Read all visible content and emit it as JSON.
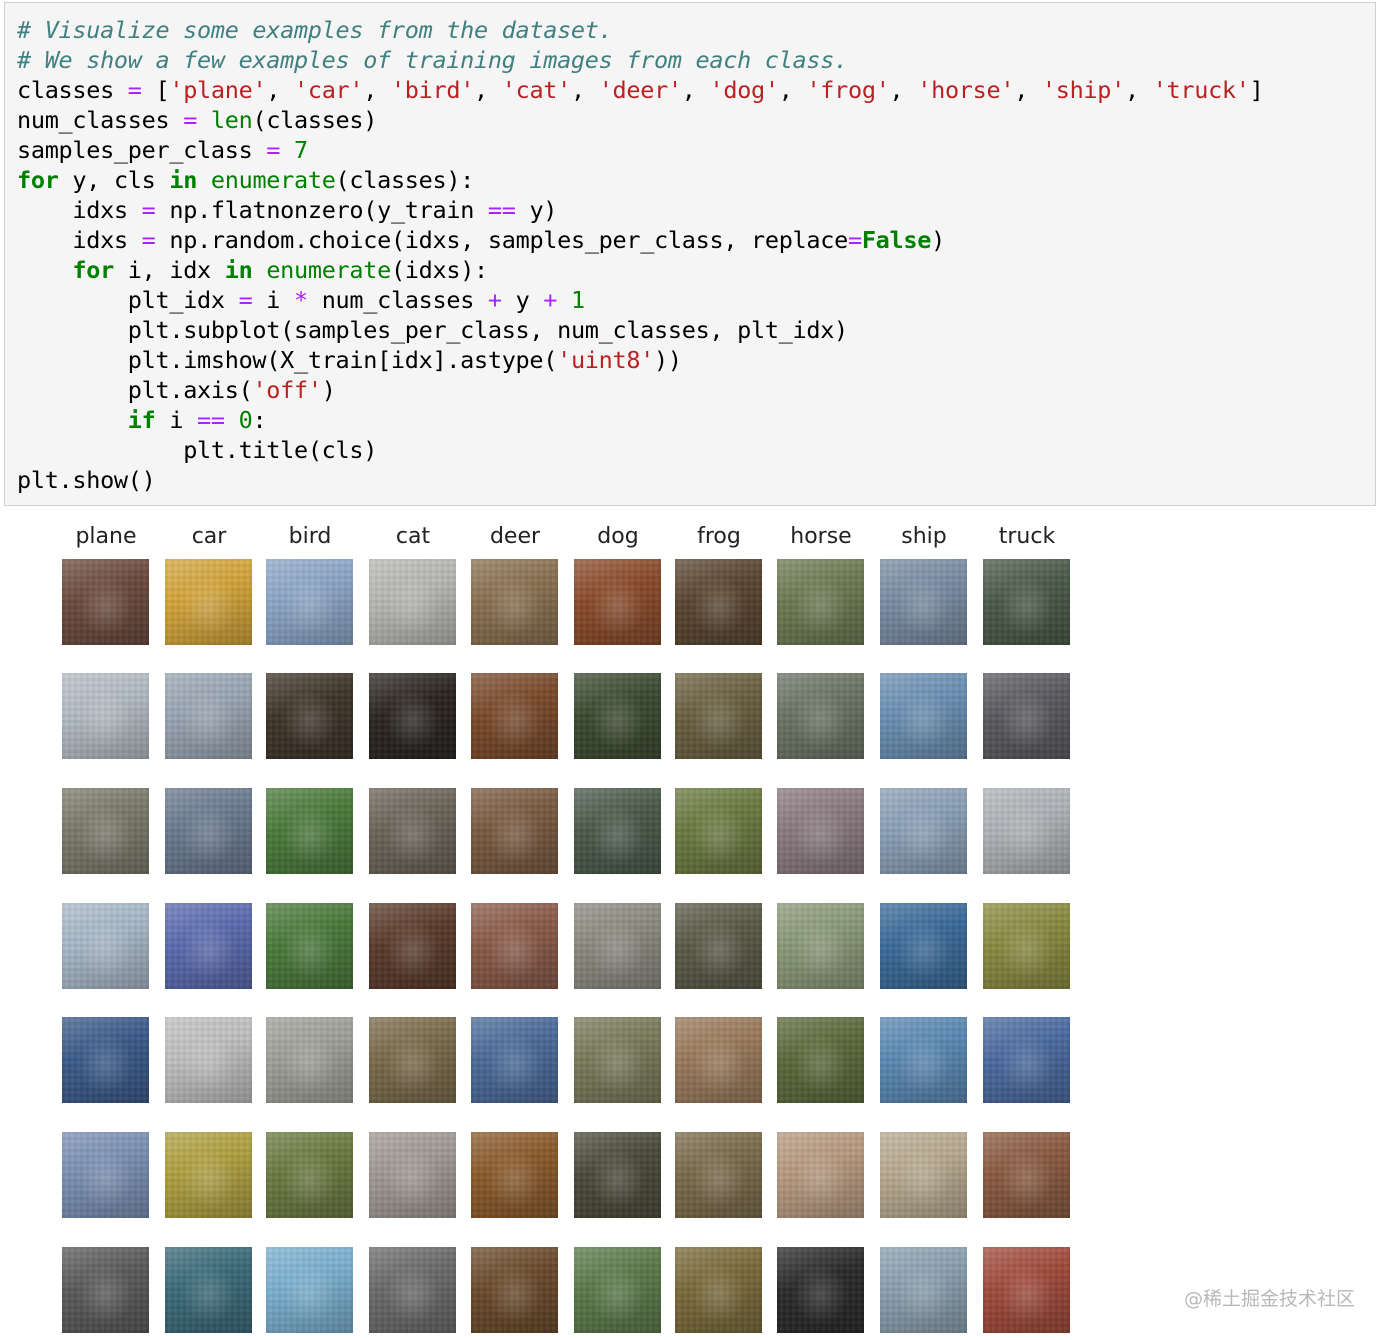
{
  "code": {
    "comment1": "# Visualize some examples from the dataset.",
    "comment2": "# We show a few examples of training images from each class.",
    "line_classes": {
      "var": "classes",
      "items": [
        "'plane'",
        "'car'",
        "'bird'",
        "'cat'",
        "'deer'",
        "'dog'",
        "'frog'",
        "'horse'",
        "'ship'",
        "'truck'"
      ]
    },
    "line_num_classes": {
      "var": "num_classes",
      "fn": "len",
      "arg": "(classes)"
    },
    "line_samples": {
      "var": "samples_per_class",
      "value": "7"
    },
    "line_for1": {
      "kw_for": "for",
      "vars": " y, cls ",
      "kw_in": "in",
      "fn": "enumerate",
      "arg": "(classes):"
    },
    "line_idxs1": {
      "var": "idxs",
      "call": "np.flatnonzero(y_train ",
      "op": "==",
      "rest": " y)"
    },
    "line_idxs2": {
      "var": "idxs",
      "call": "np.random.choice(idxs, samples_per_class, replace",
      "op": "=",
      "kw": "False",
      "rest": ")"
    },
    "line_for2": {
      "kw_for": "for",
      "vars": " i, idx ",
      "kw_in": "in",
      "fn": "enumerate",
      "arg": "(idxs):"
    },
    "line_pltidx": {
      "var": "plt_idx",
      "a": " i ",
      "b": " num_classes ",
      "c": " y ",
      "one": "1"
    },
    "line_subplot": "plt.subplot(samples_per_class, num_classes, plt_idx)",
    "line_imshow": {
      "pre": "plt.imshow(X_train[idx].astype(",
      "str": "'uint8'",
      "post": "))"
    },
    "line_axis": {
      "pre": "plt.axis(",
      "str": "'off'",
      "post": ")"
    },
    "line_if": {
      "kw": "if",
      "mid": " i ",
      "op": "==",
      "zero": "0",
      "post": ":"
    },
    "line_title": "plt.title(cls)",
    "line_show": "plt.show()"
  },
  "output": {
    "titles": [
      "plane",
      "car",
      "bird",
      "cat",
      "deer",
      "dog",
      "frog",
      "horse",
      "ship",
      "truck"
    ],
    "tile_colors": [
      [
        "#6b4a3c",
        "#d4a43a",
        "#8ca6c8",
        "#b8b8b4",
        "#8a7050",
        "#8a4a2a",
        "#5a4530",
        "#6c7a52",
        "#7a8ca4",
        "#4a5a48"
      ],
      [
        "#b4bcc4",
        "#9aa6b4",
        "#3e3428",
        "#2a2420",
        "#7a4a2a",
        "#3a4a30",
        "#6a6040",
        "#6a7464",
        "#6a90b4",
        "#5a5a60"
      ],
      [
        "#7a7a6a",
        "#6a7a90",
        "#4a7a3a",
        "#6a6458",
        "#7a5a40",
        "#4a5a4a",
        "#6a7a40",
        "#8a7a80",
        "#8aa0b8",
        "#b0b4b8"
      ],
      [
        "#a8b8c8",
        "#5a6ab0",
        "#4a7a3a",
        "#5a3a2a",
        "#8a5a48",
        "#8a8a80",
        "#5a5a48",
        "#8a9a78",
        "#3a6a9a",
        "#8a8a40"
      ],
      [
        "#3a5a8a",
        "#c0c0c0",
        "#a0a09a",
        "#7a6a4a",
        "#4a6a9a",
        "#7a7a5a",
        "#9a7a5a",
        "#5a6a3a",
        "#5a88b4",
        "#4a6aa0"
      ],
      [
        "#7a90b4",
        "#b0a040",
        "#6a7a40",
        "#a09a94",
        "#8a5a2a",
        "#4a4a3a",
        "#7a6a4a",
        "#b89a80",
        "#b8aa90",
        "#8a5a40"
      ],
      [
        "#5a5a5a",
        "#3a6a7a",
        "#7ab0d0",
        "#6a6a6a",
        "#6a4a2a",
        "#5a7a4a",
        "#7a6a3a",
        "#2a2a2a",
        "#8aa0b0",
        "#a04a3a"
      ]
    ],
    "watermark": "@稀土掘金技术社区"
  }
}
